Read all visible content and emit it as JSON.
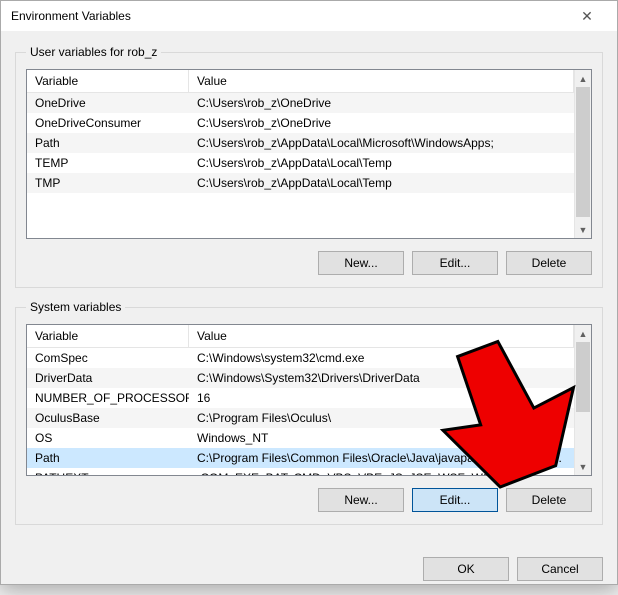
{
  "title": "Environment Variables",
  "user_section": {
    "legend": "User variables for rob_z",
    "columns": {
      "variable": "Variable",
      "value": "Value"
    },
    "rows": [
      {
        "variable": "OneDrive",
        "value": "C:\\Users\\rob_z\\OneDrive"
      },
      {
        "variable": "OneDriveConsumer",
        "value": "C:\\Users\\rob_z\\OneDrive"
      },
      {
        "variable": "Path",
        "value": "C:\\Users\\rob_z\\AppData\\Local\\Microsoft\\WindowsApps;"
      },
      {
        "variable": "TEMP",
        "value": "C:\\Users\\rob_z\\AppData\\Local\\Temp"
      },
      {
        "variable": "TMP",
        "value": "C:\\Users\\rob_z\\AppData\\Local\\Temp"
      }
    ],
    "buttons": {
      "new": "New...",
      "edit": "Edit...",
      "delete": "Delete"
    }
  },
  "system_section": {
    "legend": "System variables",
    "columns": {
      "variable": "Variable",
      "value": "Value"
    },
    "rows": [
      {
        "variable": "ComSpec",
        "value": "C:\\Windows\\system32\\cmd.exe"
      },
      {
        "variable": "DriverData",
        "value": "C:\\Windows\\System32\\Drivers\\DriverData"
      },
      {
        "variable": "NUMBER_OF_PROCESSORS",
        "value": "16"
      },
      {
        "variable": "OculusBase",
        "value": "C:\\Program Files\\Oculus\\"
      },
      {
        "variable": "OS",
        "value": "Windows_NT"
      },
      {
        "variable": "Path",
        "value": "C:\\Program Files\\Common Files\\Oracle\\Java\\javapath;C:\\Program ..."
      },
      {
        "variable": "PATHEXT",
        "value": ".COM;.EXE;.BAT;.CMD;.VBS;.VBE;.JS;.JSE;.WSF;.WSH;.MSC"
      }
    ],
    "selected_index": 5,
    "buttons": {
      "new": "New...",
      "edit": "Edit...",
      "delete": "Delete"
    }
  },
  "dialog_buttons": {
    "ok": "OK",
    "cancel": "Cancel"
  }
}
